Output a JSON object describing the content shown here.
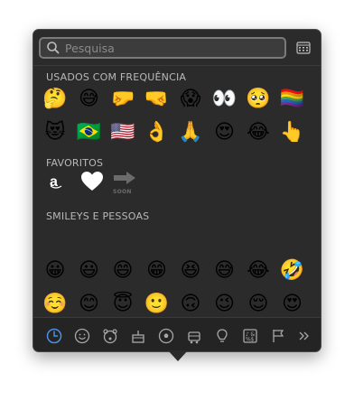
{
  "search": {
    "placeholder": "Pesquisa"
  },
  "sections": {
    "frequent": {
      "title": "USADOS COM FREQUÊNCIA",
      "emojis": [
        "🤔",
        "😅",
        "🤛",
        "🤜",
        "😱",
        "👀",
        "🥺",
        "🏳️‍🌈",
        "😻",
        "🇧🇷",
        "🇺🇸",
        "👌",
        "🙏",
        "😍",
        "😂",
        "👆"
      ]
    },
    "favorites": {
      "title": "FAVORITOS",
      "items": [
        "amazon-icon",
        "heart-icon",
        "soon-arrow-icon"
      ],
      "soon_label": "SOON"
    },
    "smileys": {
      "title": "SMILEYS E PESSOAS",
      "emojis": [
        "😀",
        "😃",
        "😄",
        "😁",
        "😆",
        "😅",
        "😂",
        "🤣",
        "☺️",
        "😊",
        "😇",
        "🙂",
        "🙃",
        "😉",
        "😌",
        "😍",
        "🥰",
        "😘",
        "😗",
        "😙",
        "😚",
        "😋",
        "😛",
        "😝"
      ]
    }
  },
  "categories": [
    "clock-icon",
    "smiley-icon",
    "bear-icon",
    "cake-icon",
    "soccer-ball-icon",
    "car-icon",
    "lightbulb-icon",
    "symbols-icon",
    "flag-icon",
    "more-chevrons-icon"
  ],
  "colors": {
    "panel": "#2b2b2b",
    "accent": "#4a90e2",
    "text": "#b9b9b9"
  }
}
